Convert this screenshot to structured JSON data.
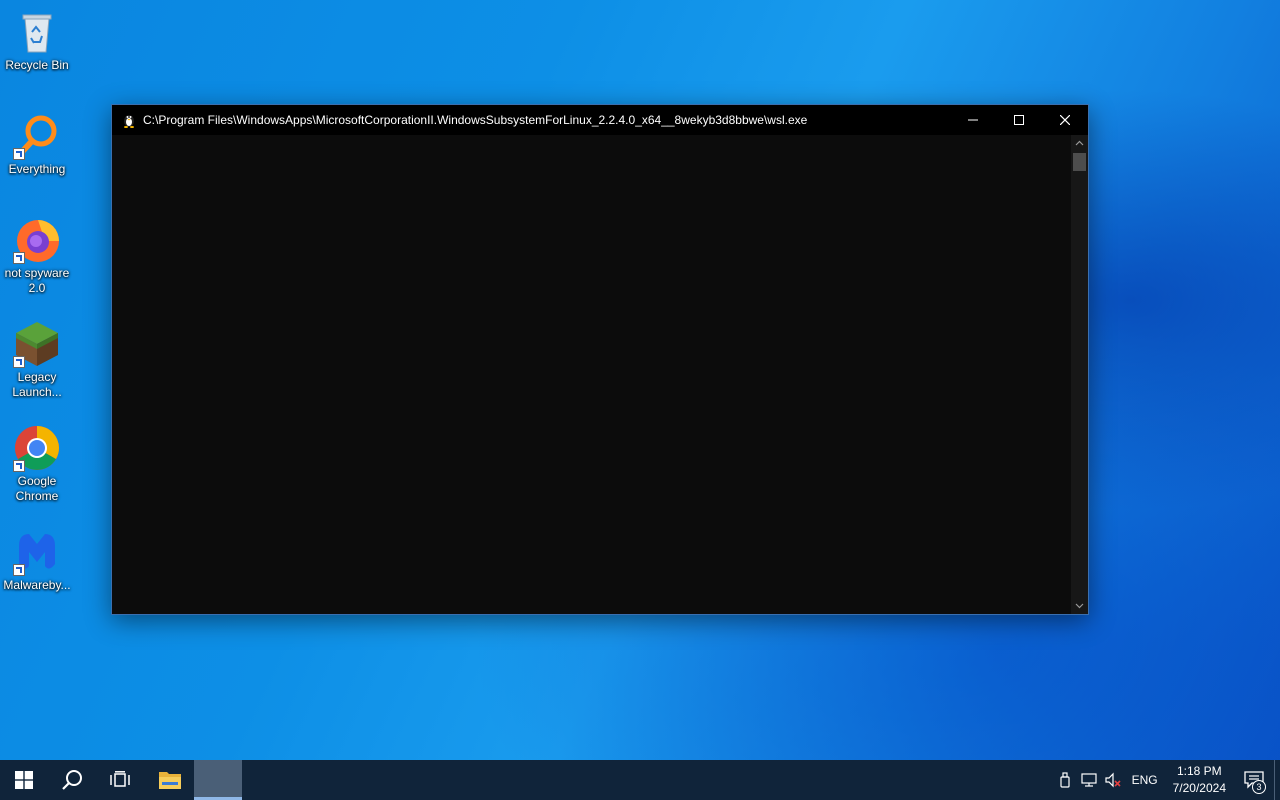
{
  "desktop": {
    "icons": [
      {
        "label": "Recycle Bin"
      },
      {
        "label": "Everything"
      },
      {
        "label": "not spyware 2.0"
      },
      {
        "label": "Legacy Launch..."
      },
      {
        "label": "Google Chrome"
      },
      {
        "label": "Malwareby..."
      }
    ]
  },
  "window": {
    "title": "C:\\Program Files\\WindowsApps\\MicrosoftCorporationII.WindowsSubsystemForLinux_2.2.4.0_x64__8wekyb3d8bbwe\\wsl.exe",
    "icon": "tux-penguin-icon"
  },
  "taskbar": {
    "language": "ENG",
    "time": "1:18 PM",
    "date": "7/20/2024",
    "notification_count": "3"
  }
}
